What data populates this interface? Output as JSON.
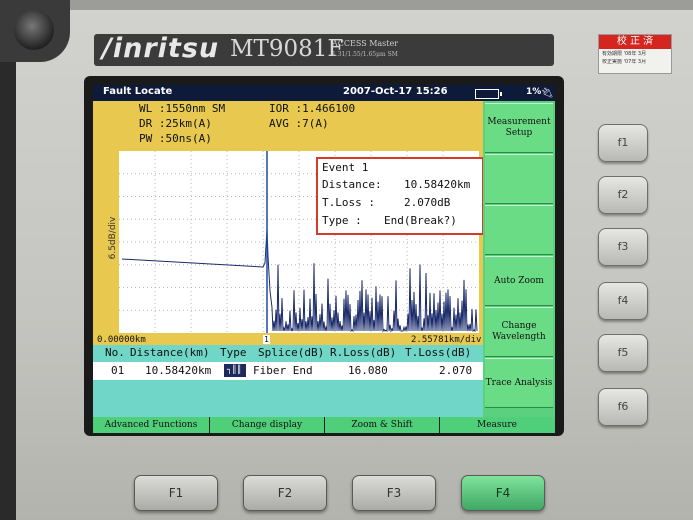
{
  "device": {
    "brand": "/inritsu",
    "model": "MT9081F",
    "series": "ACCESS Master",
    "spec": "1.31/1.55/1.65μm SM",
    "calibration": {
      "title": "校 正 済",
      "line1": "有効期限 '08年 3月",
      "line2": "校正実施 '07年 3月",
      "line3": "オリックス・レンテック株式会社"
    }
  },
  "screen": {
    "title": "Fault Locate",
    "datetime": "2007-Oct-17 15:26",
    "battery_level": "1%",
    "icons": {
      "battery": "battery-icon",
      "power": "plug-icon"
    }
  },
  "params": {
    "wl": "WL :1550nm SM",
    "ior": "IOR :1.466100",
    "dr": "DR :25km(A)",
    "avg": "AVG :7(A)",
    "pw": "PW :50ns(A)"
  },
  "graph": {
    "ylabel": "6.5dB/div",
    "x_start": "0.00000km",
    "x_end": "2.55781km/div",
    "cursor_marker": "1",
    "trace_color": "#1a2a6a",
    "background": "#ffffff",
    "grid": true
  },
  "event": {
    "title": "Event 1",
    "distance_label": "Distance:",
    "distance": "10.58420km",
    "tloss_label": "T.Loss :",
    "tloss": "2.070dB",
    "type_label": "Type :",
    "type": "End(Break?)"
  },
  "table": {
    "headers": [
      "No.",
      "Distance(km)",
      "Type",
      "Splice(dB)",
      "R.Loss(dB)",
      "T.Loss(dB)"
    ],
    "rows": [
      {
        "no": "01",
        "distance": "10.58420km",
        "type_icon": "fiber-end-icon",
        "type": "Fiber End",
        "splice": "",
        "rloss": "16.080",
        "tloss": "2.070"
      }
    ]
  },
  "softkeys": [
    "Measurement Setup",
    "",
    "",
    "Auto Zoom",
    "Change Wavelength",
    "Trace Analysis"
  ],
  "menu": [
    "Advanced Functions",
    "Change display",
    "Zoom & Shift",
    "Measure"
  ],
  "hardware_side_keys": [
    "f1",
    "f2",
    "f3",
    "f4",
    "f5",
    "f6"
  ],
  "hardware_bottom_keys": [
    "F1",
    "F2",
    "F3",
    "F4"
  ],
  "colors": {
    "screen_bg": "#e8c84f",
    "title_bar": "#0e1a3a",
    "softkey": "#6bdc86",
    "table": "#6fd6c8",
    "event_border": "#d23c2c"
  }
}
